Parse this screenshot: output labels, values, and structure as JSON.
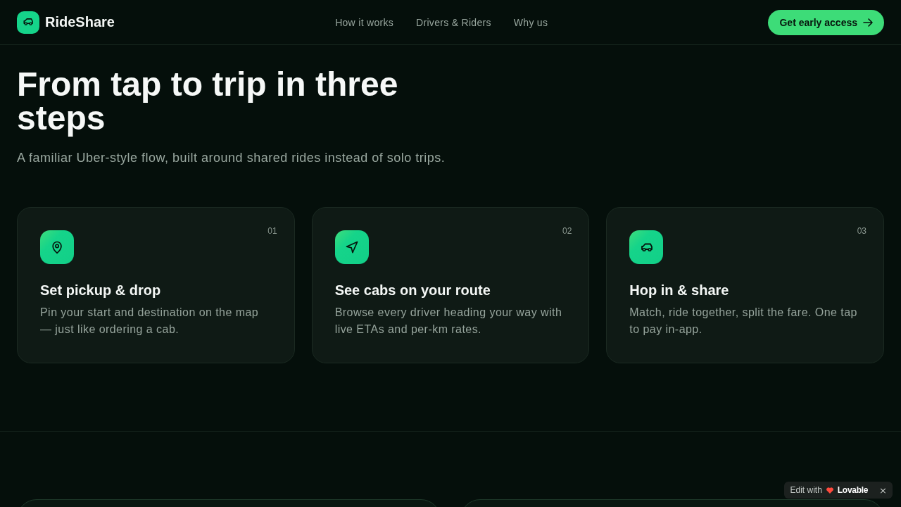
{
  "brand": {
    "name": "RideShare"
  },
  "nav": {
    "links": [
      {
        "label": "How it works"
      },
      {
        "label": "Drivers & Riders"
      },
      {
        "label": "Why us"
      }
    ],
    "cta": "Get early access"
  },
  "hero": {
    "title": "From tap to trip in three steps",
    "subtitle": "A familiar Uber-style flow, built around shared rides instead of solo trips."
  },
  "steps": [
    {
      "number": "01",
      "kind": "pin",
      "title": "Set pickup & drop",
      "text": "Pin your start and destination on the map — just like ordering a cab."
    },
    {
      "number": "02",
      "kind": "navigation",
      "title": "See cabs on your route",
      "text": "Browse every driver heading your way with live ETAs and per-km rates."
    },
    {
      "number": "03",
      "kind": "car",
      "title": "Hop in & share",
      "text": "Match, ride together, split the fare. One tap to pay in-app."
    }
  ],
  "badge": {
    "label": "Edit with",
    "brand": "Lovable",
    "close": "×"
  }
}
